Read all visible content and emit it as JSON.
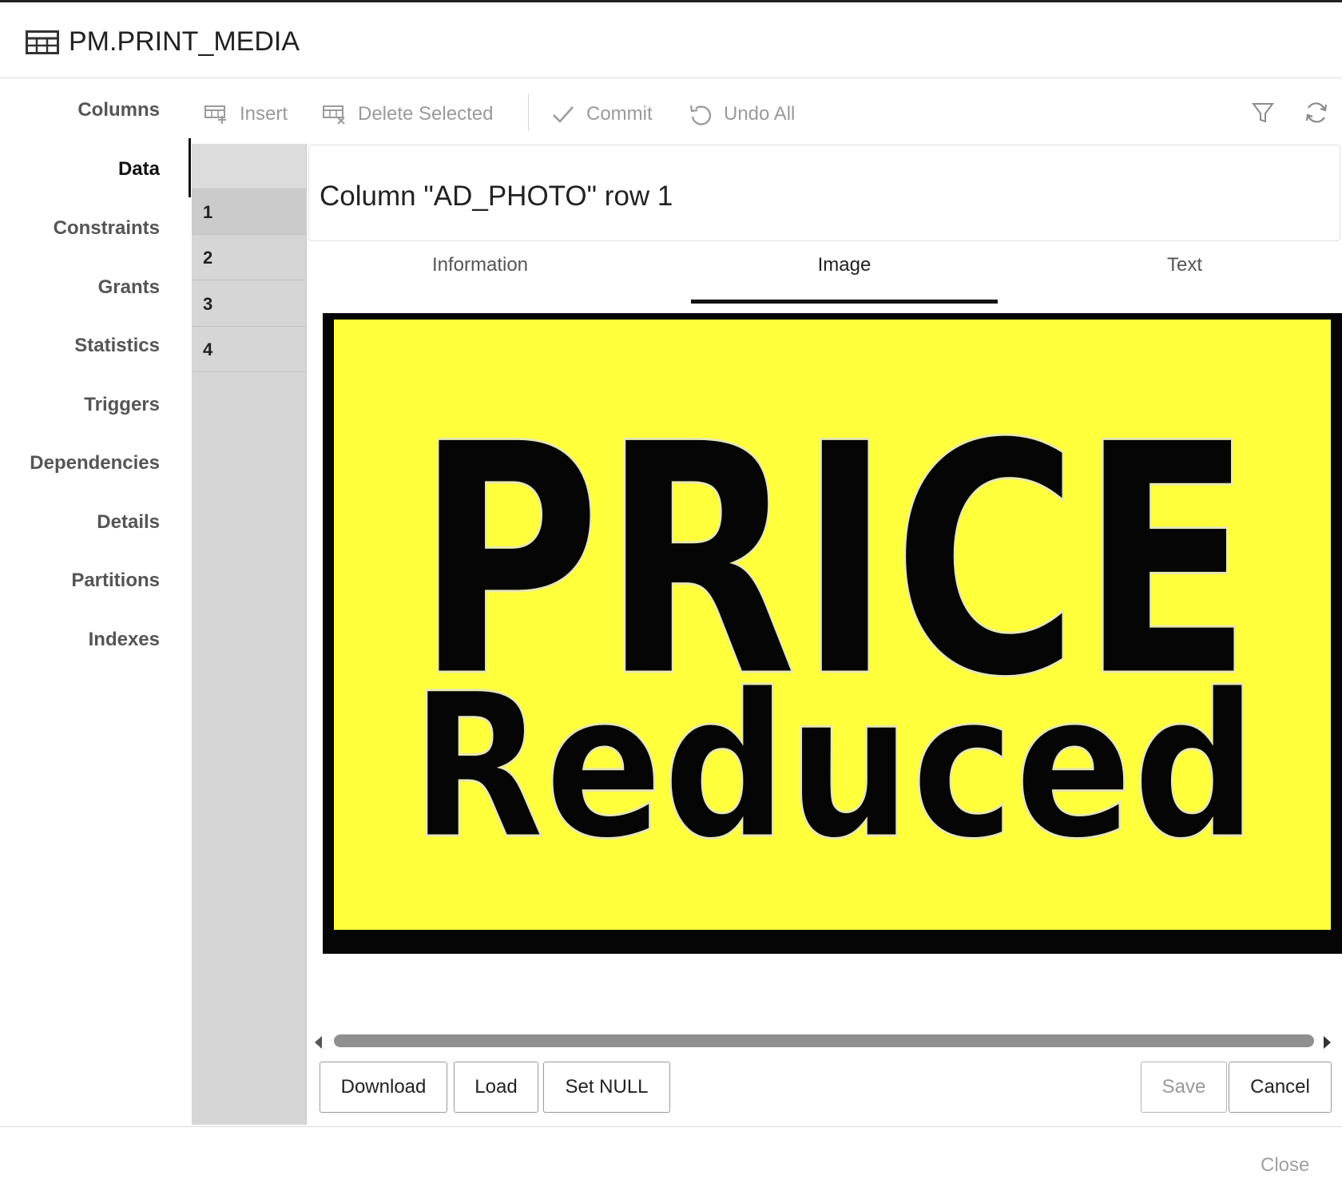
{
  "window": {
    "title": "PM.PRINT_MEDIA",
    "title_icon": "table-grid-icon"
  },
  "nav": {
    "items": [
      {
        "label": "Columns",
        "active": false
      },
      {
        "label": "Data",
        "active": true
      },
      {
        "label": "Constraints",
        "active": false
      },
      {
        "label": "Grants",
        "active": false
      },
      {
        "label": "Statistics",
        "active": false
      },
      {
        "label": "Triggers",
        "active": false
      },
      {
        "label": "Dependencies",
        "active": false
      },
      {
        "label": "Details",
        "active": false
      },
      {
        "label": "Partitions",
        "active": false
      },
      {
        "label": "Indexes",
        "active": false
      }
    ]
  },
  "toolbar": {
    "insert": {
      "label": "Insert",
      "icon": "table-insert-icon"
    },
    "delete_selected": {
      "label": "Delete Selected",
      "icon": "table-delete-icon"
    },
    "commit": {
      "label": "Commit",
      "icon": "check-icon"
    },
    "undo_all": {
      "label": "Undo All",
      "icon": "undo-icon"
    },
    "filter_icon": "filter-icon",
    "refresh_icon": "refresh-icon",
    "disabled_color": "#9a9a9a"
  },
  "rows": [
    "1",
    "2",
    "3",
    "4"
  ],
  "selected_row": "1",
  "editor": {
    "title": "Column \"AD_PHOTO\" row 1",
    "tabs": [
      {
        "label": "Information",
        "active": false
      },
      {
        "label": "Image",
        "active": true
      },
      {
        "label": "Text",
        "active": false
      }
    ],
    "image": {
      "line1": "PRICE",
      "line2": "Reduced",
      "background": "#ffff3c",
      "ink": "#050505"
    },
    "buttons": {
      "download": "Download",
      "load": "Load",
      "set_null": "Set NULL",
      "save": "Save",
      "cancel": "Cancel"
    }
  },
  "footer": {
    "close": "Close"
  }
}
